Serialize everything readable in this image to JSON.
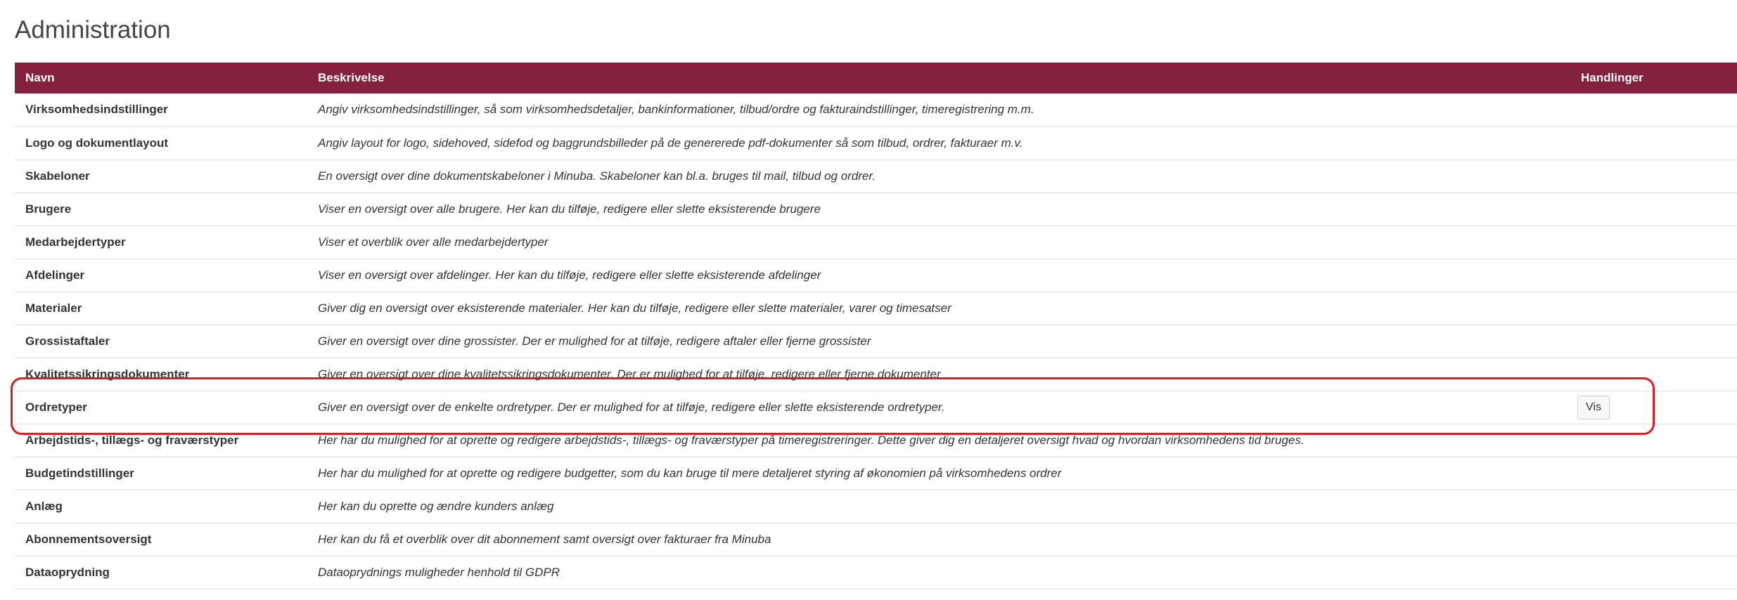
{
  "page": {
    "title": "Administration"
  },
  "table": {
    "headers": {
      "name": "Navn",
      "description": "Beskrivelse",
      "actions": "Handlinger"
    },
    "rows": [
      {
        "name": "Virksomhedsindstillinger",
        "description": "Angiv virksomhedsindstillinger, så som virksomhedsdetaljer, bankinformationer, tilbud/ordre og fakturaindstillinger, timeregistrering m.m.",
        "action": ""
      },
      {
        "name": "Logo og dokumentlayout",
        "description": "Angiv layout for logo, sidehoved, sidefod og baggrundsbilleder på de genererede pdf-dokumenter så som tilbud, ordrer, fakturaer m.v.",
        "action": ""
      },
      {
        "name": "Skabeloner",
        "description": "En oversigt over dine dokumentskabeloner i Minuba. Skabeloner kan bl.a. bruges til mail, tilbud og ordrer.",
        "action": ""
      },
      {
        "name": "Brugere",
        "description": "Viser en oversigt over alle brugere. Her kan du tilføje, redigere eller slette eksisterende brugere",
        "action": ""
      },
      {
        "name": "Medarbejdertyper",
        "description": "Viser et overblik over alle medarbejdertyper",
        "action": ""
      },
      {
        "name": "Afdelinger",
        "description": "Viser en oversigt over afdelinger. Her kan du tilføje, redigere eller slette eksisterende afdelinger",
        "action": ""
      },
      {
        "name": "Materialer",
        "description": "Giver dig en oversigt over eksisterende materialer. Her kan du tilføje, redigere eller slette materialer, varer og timesatser",
        "action": ""
      },
      {
        "name": "Grossistaftaler",
        "description": "Giver en oversigt over dine grossister. Der er mulighed for at tilføje, redigere aftaler eller fjerne grossister",
        "action": ""
      },
      {
        "name": "Kvalitetssikringsdokumenter",
        "description": "Giver en oversigt over dine kvalitetssikringsdokumenter. Der er mulighed for at tilføje, redigere eller fjerne dokumenter",
        "action": ""
      },
      {
        "name": "Ordretyper",
        "description": "Giver en oversigt over de enkelte ordretyper. Der er mulighed for at tilføje, redigere eller slette eksisterende ordretyper.",
        "action": "Vis"
      },
      {
        "name": "Arbejdstids-, tillægs- og fraværstyper",
        "description": "Her har du mulighed for at oprette og redigere arbejdstids-, tillægs- og fraværstyper på timeregistreringer. Dette giver dig en detaljeret oversigt hvad og hvordan virksomhedens tid bruges.",
        "action": ""
      },
      {
        "name": "Budgetindstillinger",
        "description": "Her har du mulighed for at oprette og redigere budgetter, som du kan bruge til mere detaljeret styring af økonomien på virksomhedens ordrer",
        "action": ""
      },
      {
        "name": "Anlæg",
        "description": "Her kan du oprette og ændre kunders anlæg",
        "action": ""
      },
      {
        "name": "Abonnementsoversigt",
        "description": "Her kan du få et overblik over dit abonnement samt oversigt over fakturaer fra Minuba",
        "action": ""
      },
      {
        "name": "Dataoprydning",
        "description": "Dataoprydnings muligheder henhold til GDPR",
        "action": ""
      }
    ]
  },
  "colors": {
    "header_bg": "#84213f",
    "highlight": "#e21b23"
  }
}
